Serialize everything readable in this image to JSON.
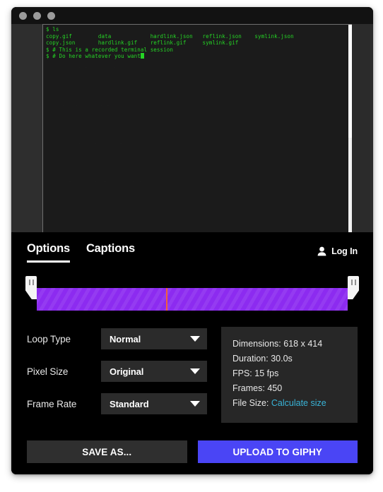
{
  "window": {
    "traffic_lights": [
      "close",
      "minimize",
      "zoom"
    ]
  },
  "preview": {
    "terminal_lines": [
      "$ ls",
      "copy.gif        data            hardlink.json   reflink.json    symlink.json",
      "copy.json       hardlink.gif    reflink.gif     symlink.gif",
      "$ # This is a recorded terminal session",
      "$ # Do here whatever you want"
    ],
    "ghost_lines": [
      "          . .        .",
      "",
      "",
      "",
      "     .   .       . .          .  .",
      "",
      "",
      "",
      "          .    .       .      .",
      "",
      "",
      "",
      "       .       .  .        . ."
    ],
    "scrollbar": "vertical-scrollbar"
  },
  "tabs": [
    {
      "label": "Options",
      "active": true
    },
    {
      "label": "Captions",
      "active": false
    }
  ],
  "account": {
    "login_label": "Log In",
    "icon": "person-icon"
  },
  "trimmer": {
    "handle_left": "trim-start-handle",
    "handle_right": "trim-end-handle",
    "playhead": "playhead-marker",
    "bar_color": "#8c2bf0",
    "playhead_color": "#f2603c"
  },
  "controls": [
    {
      "label": "Loop Type",
      "value": "Normal"
    },
    {
      "label": "Pixel Size",
      "value": "Original"
    },
    {
      "label": "Frame Rate",
      "value": "Standard"
    }
  ],
  "info": {
    "dimensions_label": "Dimensions:",
    "dimensions_value": "618 x 414",
    "duration_label": "Duration:",
    "duration_value": "30.0s",
    "fps_label": "FPS:",
    "fps_value": "15 fps",
    "frames_label": "Frames:",
    "frames_value": "450",
    "filesize_label": "File Size:",
    "filesize_link": "Calculate size",
    "link_color": "#39b3d7"
  },
  "buttons": {
    "save_as": "SAVE AS...",
    "upload": "UPLOAD TO GIPHY",
    "upload_color": "#4a45f5"
  }
}
